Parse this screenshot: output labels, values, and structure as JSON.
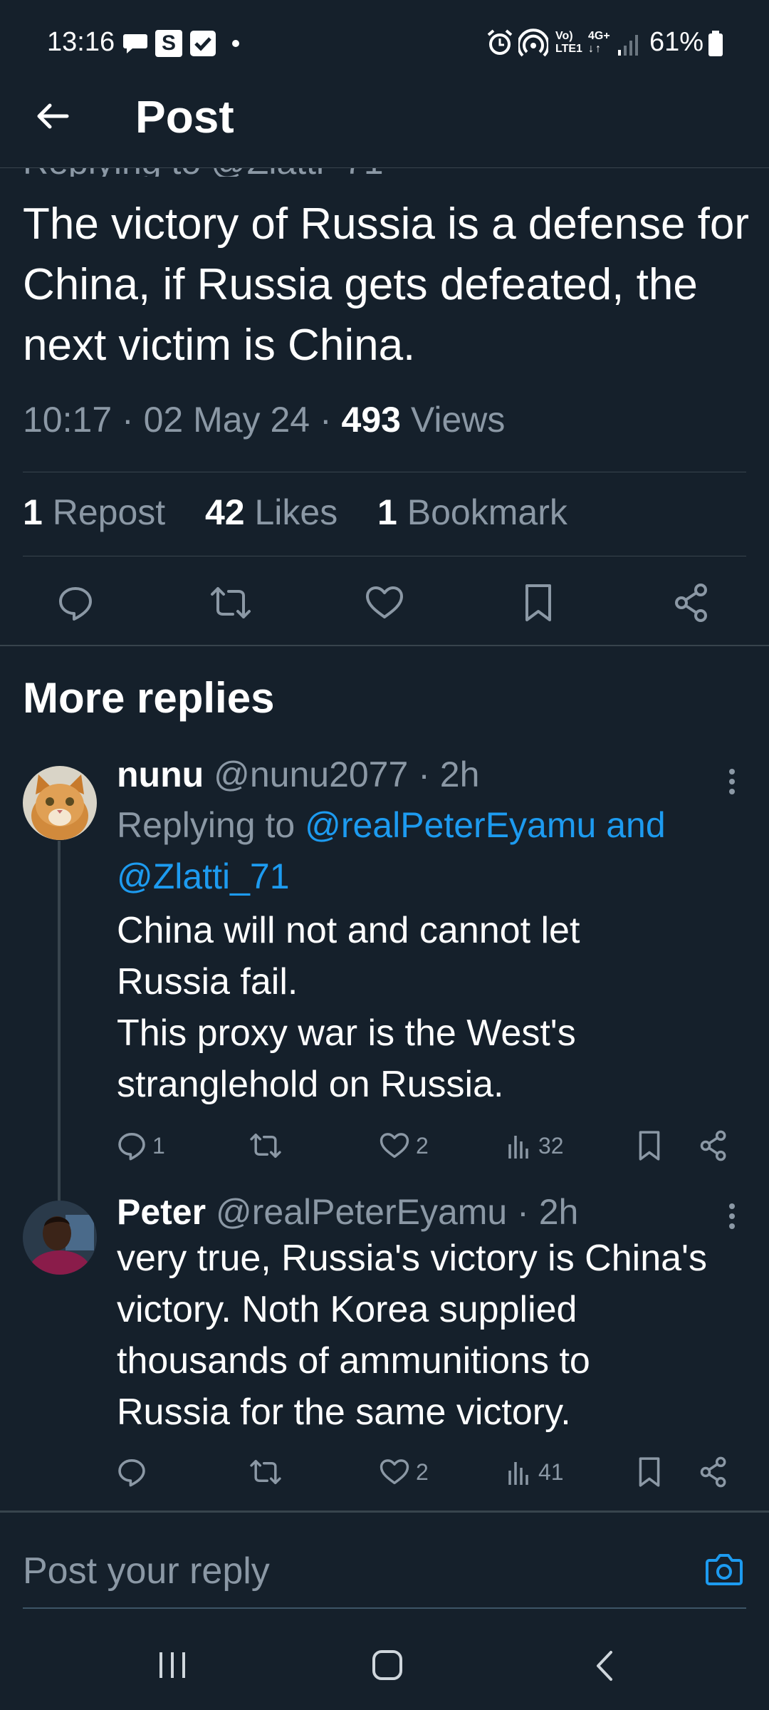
{
  "status_bar": {
    "time": "13:16",
    "battery_text": "61%",
    "notification_icons": [
      "chat-bubble-icon",
      "s-app-icon",
      "check-box-icon",
      "dot-icon"
    ],
    "system_icons": [
      "alarm-icon",
      "hotspot-icon",
      "volte-icon",
      "4g-icon",
      "signal-icon",
      "battery-icon"
    ],
    "volte_label_top": "Vo)",
    "volte_label_bottom": "LTE1",
    "net_label": "4G+"
  },
  "header": {
    "title": "Post",
    "back_icon": "arrow-left-icon"
  },
  "post": {
    "replying_to_partial": "Replying to @Zlatti_71",
    "text": "The victory of Russia is a defense for China, if Russia gets defeated, the next victim is China.",
    "time": "10:17",
    "date": "02 May 24",
    "views_count": "493",
    "views_label": "Views",
    "sep": "·",
    "reposts_count": "1",
    "reposts_label": "Repost",
    "likes_count": "42",
    "likes_label": "Likes",
    "bookmarks_count": "1",
    "bookmarks_label": "Bookmark",
    "actions": [
      "reply-icon",
      "repost-icon",
      "like-icon",
      "bookmark-icon",
      "share-icon"
    ]
  },
  "more_replies": {
    "title": "More replies"
  },
  "replies": [
    {
      "name": "nunu",
      "handle": "@nunu2077",
      "time": "2h",
      "sep": "·",
      "replying_prefix": "Replying to",
      "replying_users": "@realPeterEyamu and @Zlatti_71",
      "text_lines": [
        "China will not and cannot let",
        "Russia fail.",
        "This proxy war is the West's",
        "stranglehold on Russia."
      ],
      "reply_count": "1",
      "repost_count": "",
      "like_count": "2",
      "view_count": "32"
    },
    {
      "name": "Peter",
      "handle": "@realPeterEyamu",
      "time": "2h",
      "sep": "·",
      "text_lines": [
        "very true, Russia's victory is China's",
        "victory. Noth Korea supplied",
        "thousands of ammunitions to",
        "Russia for the same victory."
      ],
      "reply_count": "",
      "repost_count": "",
      "like_count": "2",
      "view_count": "41"
    }
  ],
  "compose": {
    "placeholder": "Post your reply",
    "camera_icon": "camera-icon"
  },
  "nav_bar": {
    "icons": [
      "recents-icon",
      "home-icon",
      "back-icon"
    ]
  },
  "colors": {
    "background": "#15202b",
    "divider": "#38444d",
    "muted_text": "#8b98a5",
    "link": "#1d9bf0",
    "text": "#ffffff"
  }
}
